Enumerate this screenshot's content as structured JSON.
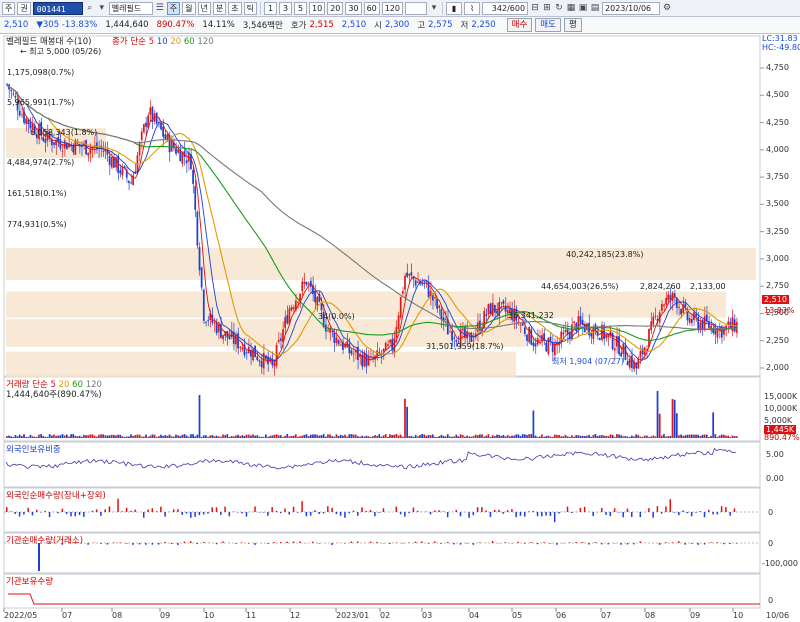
{
  "toolbar": {
    "menu_items": [
      "주",
      "권"
    ],
    "code": "001441",
    "name": "벨레필드",
    "period_items": [
      "주",
      "월",
      "년",
      "분",
      "초",
      "틱"
    ],
    "minute_items": [
      "1",
      "3",
      "5",
      "10",
      "20",
      "30",
      "60",
      "120"
    ],
    "count": "342/600",
    "date": "2023/10/06"
  },
  "quote": {
    "price": "2,510",
    "change": "305",
    "change_pct": "-13.83%",
    "volume": "1,444,640",
    "volume_pct": "890.47%",
    "turnover": "14.11%",
    "amount": "3,546백만",
    "bid_label": "호가",
    "bid": "2,515",
    "bid2": "2,510",
    "open_label": "시",
    "open": "2,300",
    "high_label": "고",
    "high": "2,575",
    "low_label": "저",
    "low": "2,250",
    "buy_label": "매수",
    "sell_label": "매도",
    "eval_label": "평"
  },
  "price_pane": {
    "title": "벨레필드 매봉대 수(10)",
    "ma_label": "종가 단순",
    "ma_periods": [
      "5",
      "10",
      "20",
      "60",
      "120"
    ],
    "ma_colors": [
      "#d11",
      "#1c3fd6",
      "#e09a00",
      "#1a9a1a",
      "#777777"
    ],
    "right_top_1": "LC:31.83",
    "right_top_2": "HC:-49.80",
    "high_anno": "최고 5,000 (05/26)",
    "low_anno": "최저 1,904 (07/27)",
    "current_tag": "2,510",
    "current_pct_tag": "13.83%",
    "y_ticks": [
      "4,750",
      "4,500",
      "4,250",
      "4,000",
      "3,750",
      "3,500",
      "3,250",
      "3,000",
      "2,750",
      "2,500",
      "2,250",
      "2,000"
    ],
    "volume_profile": [
      {
        "label": "1,175,098(0.7%)"
      },
      {
        "label": "5,965,991(1.7%)"
      },
      {
        "label": "6,058,343(1.8%)"
      },
      {
        "label": "4,484,974(2.7%)"
      },
      {
        "label": "161,518(0.1%)"
      },
      {
        "label": "774,931(0.5%)"
      },
      {
        "label": "40,242,185(23.8%)"
      },
      {
        "label": "44,654,003(26.5%)"
      },
      {
        "label": "2,824,260"
      },
      {
        "label": "2,133,00"
      },
      {
        "label": "36,341,232"
      },
      {
        "label": "31,501,959(18.7%)"
      },
      {
        "label": "34(0.0%)"
      }
    ]
  },
  "volume_pane": {
    "title": "거래량 단순",
    "ma_periods": [
      "5",
      "20",
      "60",
      "120"
    ],
    "value": "1,444,640주(890.47%)",
    "y_ticks": [
      "15,000K",
      "10,000K",
      "5,000K"
    ],
    "current_tag": "1,445K",
    "current_pct_tag": "890.47%"
  },
  "foreign_ratio_pane": {
    "title": "외국인보유비중",
    "y_ticks": [
      "5.00",
      "0.00"
    ]
  },
  "foreign_net_pane": {
    "title": "외국인순매수량(장내+장외)",
    "y_ticks": [
      "0"
    ]
  },
  "inst_net_pane": {
    "title": "기관순매수량(거래소)",
    "y_ticks": [
      "0",
      "-100,000"
    ]
  },
  "inst_hold_pane": {
    "title": "기관보유수량",
    "y_ticks": [
      "0"
    ]
  },
  "x_axis": {
    "ticks": [
      "2022/05",
      "07",
      "08",
      "09",
      "10",
      "11",
      "12",
      "2023/01",
      "02",
      "03",
      "04",
      "05",
      "06",
      "07",
      "08",
      "09",
      "10",
      "10/06"
    ]
  }
}
